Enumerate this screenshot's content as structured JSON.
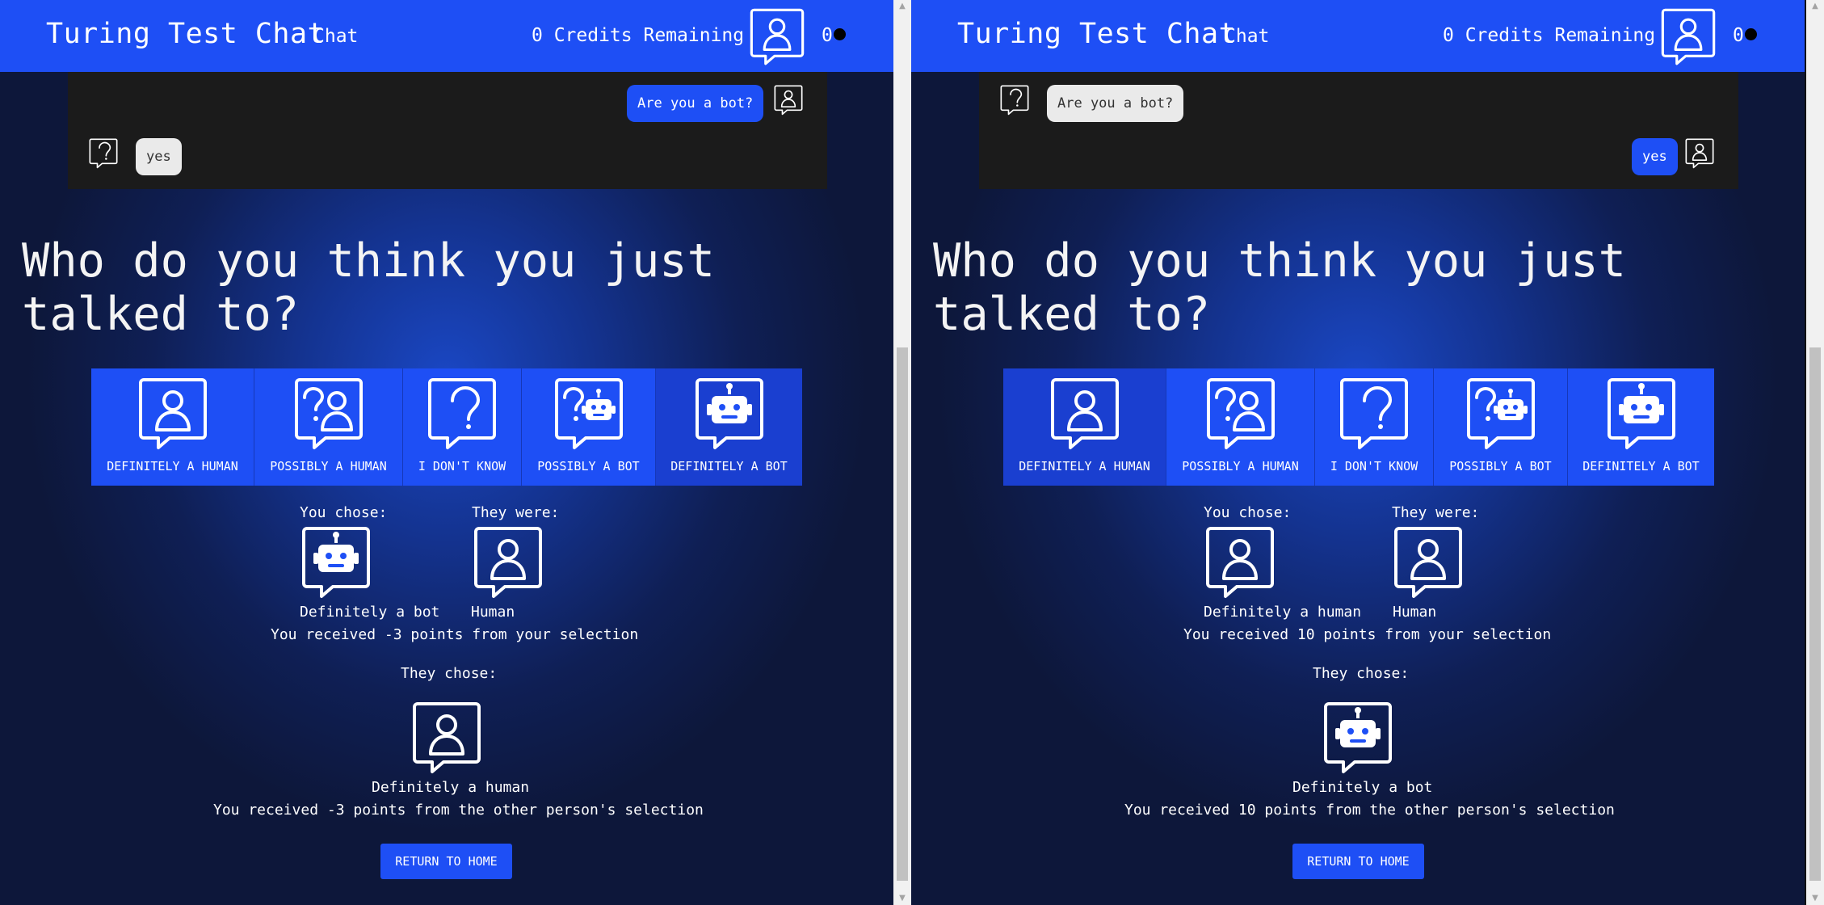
{
  "header": {
    "app_title": "Turing Test Chat",
    "app_subtitle": "Chat",
    "credits": "0 Credits Remaining",
    "count": "0"
  },
  "question": "Who do you think you just talked to?",
  "options": [
    {
      "label": "DEFINITELY A HUMAN",
      "icon": "human-icon"
    },
    {
      "label": "POSSIBLY A HUMAN",
      "icon": "possibly-human-icon"
    },
    {
      "label": "I DON'T KNOW",
      "icon": "question-icon"
    },
    {
      "label": "POSSIBLY A BOT",
      "icon": "possibly-bot-icon"
    },
    {
      "label": "DEFINITELY A BOT",
      "icon": "bot-icon"
    }
  ],
  "labels": {
    "you_chose": "You chose:",
    "they_were": "They were:",
    "they_chose": "They chose:",
    "return_home": "RETURN TO HOME"
  },
  "left": {
    "messages": [
      {
        "text": "Are you a bot?",
        "style": "blue",
        "avatar": "person-icon"
      },
      {
        "text": "yes",
        "style": "grey",
        "avatar": "question-icon"
      }
    ],
    "selected_option": "DEFINITELY A BOT",
    "you_chose_value": "Definitely a bot",
    "they_were_value": "Human",
    "your_points": "You received -3 points from your selection",
    "they_chose_value": "Definitely a human",
    "their_points": "You received -3 points from the other person's selection"
  },
  "right": {
    "messages": [
      {
        "text": "Are you a bot?",
        "style": "grey",
        "avatar": "question-icon"
      },
      {
        "text": "yes",
        "style": "blue",
        "avatar": "person-icon"
      }
    ],
    "selected_option": "DEFINITELY A HUMAN",
    "you_chose_value": "Definitely a human",
    "they_were_value": "Human",
    "your_points": "You received 10 points from your selection",
    "they_chose_value": "Definitely a bot",
    "their_points": "You received 10 points from the other person's selection"
  },
  "colors": {
    "accent": "#1e4ff5",
    "chat_bg": "#1b1b1b",
    "dark_bg": "#0f1f55"
  }
}
